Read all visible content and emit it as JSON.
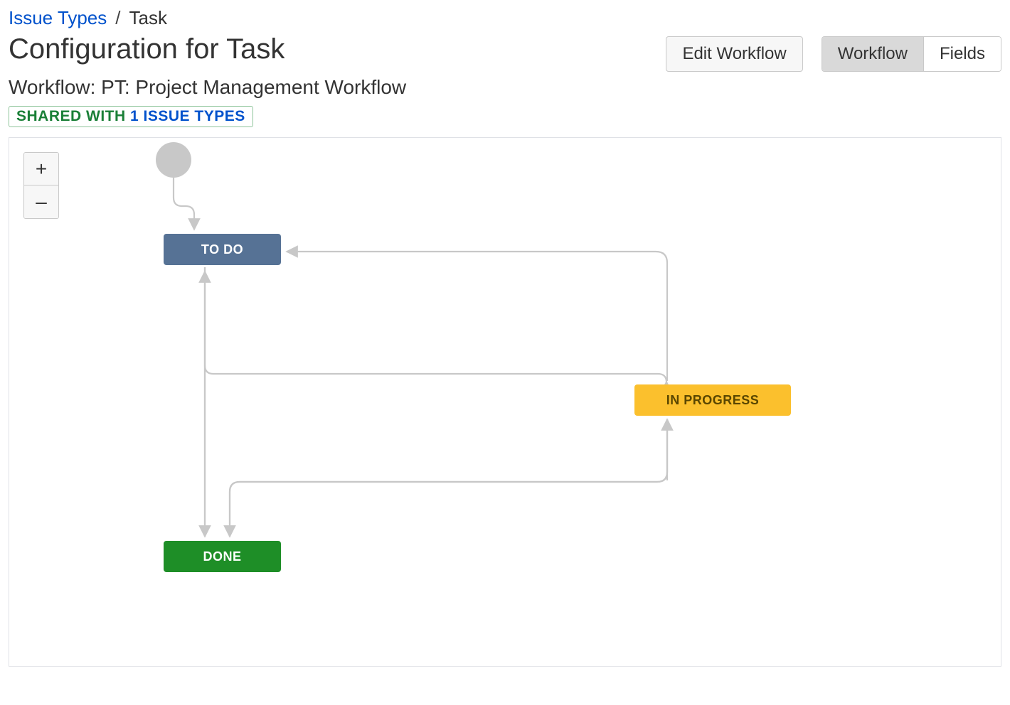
{
  "breadcrumb": {
    "parent": "Issue Types",
    "separator": "/",
    "current": "Task"
  },
  "header": {
    "title": "Configuration for Task",
    "editWorkflowLabel": "Edit Workflow",
    "tabs": {
      "workflow": "Workflow",
      "fields": "Fields"
    }
  },
  "subtitle": {
    "prefix": "Workflow:",
    "name": "PT: Project Management Workflow"
  },
  "sharedBadge": {
    "prefix": "SHARED WITH ",
    "suffix": "1 ISSUE TYPES"
  },
  "zoom": {
    "inLabel": "+",
    "outLabel": "–"
  },
  "workflow": {
    "startNodeName": "start",
    "statuses": {
      "todo": {
        "label": "TO DO"
      },
      "inProgress": {
        "label": "IN PROGRESS"
      },
      "done": {
        "label": "DONE"
      }
    },
    "colors": {
      "todo": "#567295",
      "inProgress": "#fbc02d",
      "done": "#1e8e27",
      "edge": "#c8c8c8"
    }
  }
}
